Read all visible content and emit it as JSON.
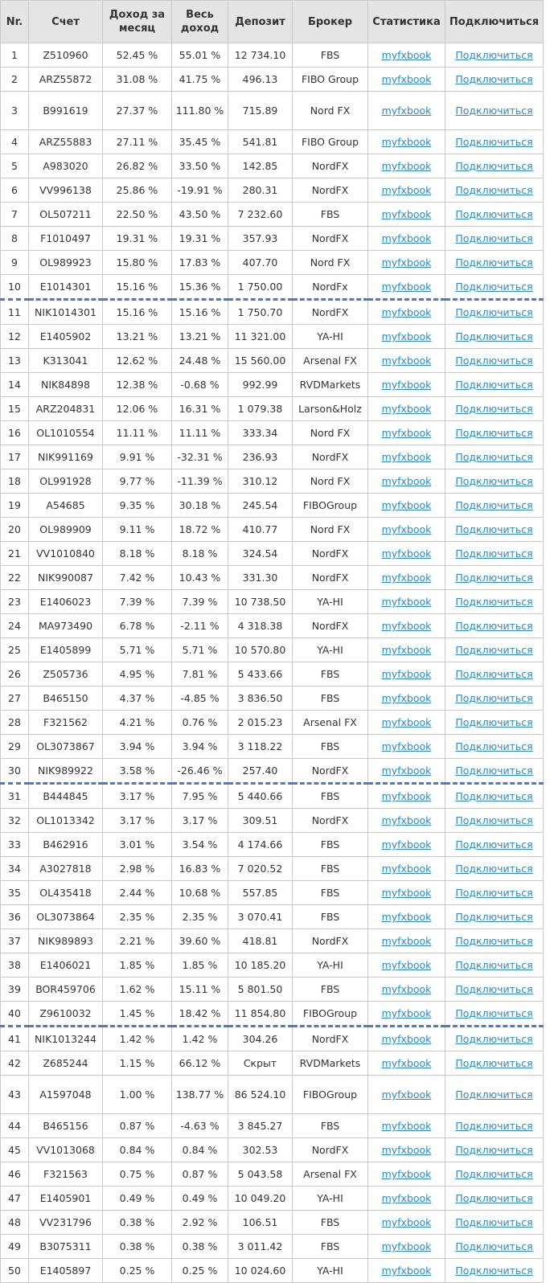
{
  "headers": [
    "Nr.",
    "Счет",
    "Доход за месяц",
    "Весь доход",
    "Депозит",
    "Брокер",
    "Статистика",
    "Подключиться"
  ],
  "separators_after": [
    10,
    30,
    40
  ],
  "rows": [
    {
      "nr": "1",
      "acc": "Z510960",
      "month": "52.45 %",
      "total": "55.01 %",
      "dep": "12 734.10",
      "broker": "FBS",
      "stat": "myfxbook",
      "conn": "Подключиться"
    },
    {
      "nr": "2",
      "acc": "ARZ55872",
      "month": "31.08 %",
      "total": "41.75 %",
      "dep": "496.13",
      "broker": "FIBO Group",
      "stat": "myfxbook",
      "conn": "Подключиться"
    },
    {
      "nr": "3",
      "acc": "B991619",
      "month": "27.37 %",
      "total": "111.80 %",
      "dep": "715.89",
      "broker": "Nord FX",
      "stat": "myfxbook",
      "conn": "Подключиться",
      "tall": true
    },
    {
      "nr": "4",
      "acc": "ARZ55883",
      "month": "27.11 %",
      "total": "35.45 %",
      "dep": "541.81",
      "broker": "FIBO Group",
      "stat": "myfxbook",
      "conn": "Подключиться"
    },
    {
      "nr": "5",
      "acc": "A983020",
      "month": "26.82 %",
      "total": "33.50 %",
      "dep": "142.85",
      "broker": "NordFX",
      "stat": "myfxbook",
      "conn": "Подключиться"
    },
    {
      "nr": "6",
      "acc": "VV996138",
      "month": "25.86 %",
      "total": "-19.91 %",
      "dep": "280.31",
      "broker": "NordFX",
      "stat": "myfxbook",
      "conn": "Подключиться"
    },
    {
      "nr": "7",
      "acc": "OL507211",
      "month": "22.50 %",
      "total": "43.50 %",
      "dep": "7 232.60",
      "broker": "FBS",
      "stat": "myfxbook",
      "conn": "Подключиться"
    },
    {
      "nr": "8",
      "acc": "F1010497",
      "month": "19.31 %",
      "total": "19.31 %",
      "dep": "357.93",
      "broker": "NordFX",
      "stat": "myfxbook",
      "conn": "Подключиться"
    },
    {
      "nr": "9",
      "acc": "OL989923",
      "month": "15.80 %",
      "total": "17.83 %",
      "dep": "407.70",
      "broker": "Nord FX",
      "stat": "myfxbook",
      "conn": "Подключиться"
    },
    {
      "nr": "10",
      "acc": "E1014301",
      "month": "15.16 %",
      "total": "15.36 %",
      "dep": "1 750.00",
      "broker": "NordFx",
      "stat": "myfxbook",
      "conn": "Подключиться"
    },
    {
      "nr": "11",
      "acc": "NIK1014301",
      "month": "15.16 %",
      "total": "15.16 %",
      "dep": "1 750.70",
      "broker": "NordFX",
      "stat": "myfxbook",
      "conn": "Подключиться"
    },
    {
      "nr": "12",
      "acc": "E1405902",
      "month": "13.21 %",
      "total": "13.21 %",
      "dep": "11 321.00",
      "broker": "YA-HI",
      "stat": "myfxbook",
      "conn": "Подключиться"
    },
    {
      "nr": "13",
      "acc": "K313041",
      "month": "12.62 %",
      "total": "24.48 %",
      "dep": "15 560.00",
      "broker": "Arsenal FX",
      "stat": "myfxbook",
      "conn": "Подключиться"
    },
    {
      "nr": "14",
      "acc": "NIK84898",
      "month": "12.38 %",
      "total": "-0.68 %",
      "dep": "992.99",
      "broker": "RVDMarkets",
      "stat": "myfxbook",
      "conn": "Подключиться"
    },
    {
      "nr": "15",
      "acc": "ARZ204831",
      "month": "12.06 %",
      "total": "16.31 %",
      "dep": "1 079.38",
      "broker": "Larson&Holz",
      "stat": "myfxbook",
      "conn": "Подключиться"
    },
    {
      "nr": "16",
      "acc": "OL1010554",
      "month": "11.11 %",
      "total": "11.11 %",
      "dep": "333.34",
      "broker": "Nord FX",
      "stat": "myfxbook",
      "conn": "Подключиться"
    },
    {
      "nr": "17",
      "acc": "NIK991169",
      "month": "9.91 %",
      "total": "-32.31 %",
      "dep": "236.93",
      "broker": "NordFX",
      "stat": "myfxbook",
      "conn": "Подключиться"
    },
    {
      "nr": "18",
      "acc": "OL991928",
      "month": "9.77 %",
      "total": "-11.39 %",
      "dep": "310.12",
      "broker": "Nord FX",
      "stat": "myfxbook",
      "conn": "Подключиться"
    },
    {
      "nr": "19",
      "acc": "A54685",
      "month": "9.35 %",
      "total": "30.18 %",
      "dep": "245.54",
      "broker": "FIBOGroup",
      "stat": "myfxbook",
      "conn": "Подключиться"
    },
    {
      "nr": "20",
      "acc": "OL989909",
      "month": "9.11 %",
      "total": "18.72 %",
      "dep": "410.77",
      "broker": "Nord FX",
      "stat": "myfxbook",
      "conn": "Подключиться"
    },
    {
      "nr": "21",
      "acc": "VV1010840",
      "month": "8.18 %",
      "total": "8.18 %",
      "dep": "324.54",
      "broker": "NordFX",
      "stat": "myfxbook",
      "conn": "Подключиться"
    },
    {
      "nr": "22",
      "acc": "NIK990087",
      "month": "7.42 %",
      "total": "10.43 %",
      "dep": "331.30",
      "broker": "NordFX",
      "stat": "myfxbook",
      "conn": "Подключиться"
    },
    {
      "nr": "23",
      "acc": "E1406023",
      "month": "7.39 %",
      "total": "7.39 %",
      "dep": "10 738.50",
      "broker": "YA-HI",
      "stat": "myfxbook",
      "conn": "Подключиться"
    },
    {
      "nr": "24",
      "acc": "MA973490",
      "month": "6.78 %",
      "total": "-2.11 %",
      "dep": "4 318.38",
      "broker": "NordFX",
      "stat": "myfxbook",
      "conn": "Подключиться"
    },
    {
      "nr": "25",
      "acc": "E1405899",
      "month": "5.71 %",
      "total": "5.71 %",
      "dep": "10 570.80",
      "broker": "YA-HI",
      "stat": "myfxbook",
      "conn": "Подключиться"
    },
    {
      "nr": "26",
      "acc": "Z505736",
      "month": "4.95 %",
      "total": "7.81 %",
      "dep": "5 433.66",
      "broker": "FBS",
      "stat": "myfxbook",
      "conn": "Подключиться"
    },
    {
      "nr": "27",
      "acc": "B465150",
      "month": "4.37 %",
      "total": "-4.85 %",
      "dep": "3 836.50",
      "broker": "FBS",
      "stat": "myfxbook",
      "conn": "Подключиться"
    },
    {
      "nr": "28",
      "acc": "F321562",
      "month": "4.21 %",
      "total": "0.76 %",
      "dep": "2 015.23",
      "broker": "Arsenal FX",
      "stat": "myfxbook",
      "conn": "Подключиться"
    },
    {
      "nr": "29",
      "acc": "OL3073867",
      "month": "3.94 %",
      "total": "3.94 %",
      "dep": "3 118.22",
      "broker": "FBS",
      "stat": "myfxbook",
      "conn": "Подключиться"
    },
    {
      "nr": "30",
      "acc": "NIK989922",
      "month": "3.58 %",
      "total": "-26.46 %",
      "dep": "257.40",
      "broker": "NordFX",
      "stat": "myfxbook",
      "conn": "Подключиться"
    },
    {
      "nr": "31",
      "acc": "B444845",
      "month": "3.17 %",
      "total": "7.95 %",
      "dep": "5 440.66",
      "broker": "FBS",
      "stat": "myfxbook",
      "conn": "Подключиться"
    },
    {
      "nr": "32",
      "acc": "OL1013342",
      "month": "3.17 %",
      "total": "3.17 %",
      "dep": "309.51",
      "broker": "NordFX",
      "stat": "myfxbook",
      "conn": "Подключиться"
    },
    {
      "nr": "33",
      "acc": "B462916",
      "month": "3.01 %",
      "total": "3.54 %",
      "dep": "4 174.66",
      "broker": "FBS",
      "stat": "myfxbook",
      "conn": "Подключиться"
    },
    {
      "nr": "34",
      "acc": "A3027818",
      "month": "2.98 %",
      "total": "16.83 %",
      "dep": "7 020.52",
      "broker": "FBS",
      "stat": "myfxbook",
      "conn": "Подключиться"
    },
    {
      "nr": "35",
      "acc": "OL435418",
      "month": "2.44 %",
      "total": "10.68 %",
      "dep": "557.85",
      "broker": "FBS",
      "stat": "myfxbook",
      "conn": "Подключиться"
    },
    {
      "nr": "36",
      "acc": "OL3073864",
      "month": "2.35 %",
      "total": "2.35 %",
      "dep": "3 070.41",
      "broker": "FBS",
      "stat": "myfxbook",
      "conn": "Подключиться"
    },
    {
      "nr": "37",
      "acc": "NIK989893",
      "month": "2.21 %",
      "total": "39.60 %",
      "dep": "418.81",
      "broker": "NordFX",
      "stat": "myfxbook",
      "conn": "Подключиться"
    },
    {
      "nr": "38",
      "acc": "E1406021",
      "month": "1.85 %",
      "total": "1.85 %",
      "dep": "10 185.20",
      "broker": "YA-HI",
      "stat": "myfxbook",
      "conn": "Подключиться"
    },
    {
      "nr": "39",
      "acc": "BOR459706",
      "month": "1.62 %",
      "total": "15.11 %",
      "dep": "5 801.50",
      "broker": "FBS",
      "stat": "myfxbook",
      "conn": "Подключиться"
    },
    {
      "nr": "40",
      "acc": "Z9610032",
      "month": "1.45 %",
      "total": "18.42 %",
      "dep": "11 854.80",
      "broker": "FIBOGroup",
      "stat": "myfxbook",
      "conn": "Подключиться"
    },
    {
      "nr": "41",
      "acc": "NIK1013244",
      "month": "1.42 %",
      "total": "1.42 %",
      "dep": "304.26",
      "broker": "NordFX",
      "stat": "myfxbook",
      "conn": "Подключиться"
    },
    {
      "nr": "42",
      "acc": "Z685244",
      "month": "1.15 %",
      "total": "66.12 %",
      "dep": "Скрыт",
      "broker": "RVDMarkets",
      "stat": "myfxbook",
      "conn": "Подключиться"
    },
    {
      "nr": "43",
      "acc": "A1597048",
      "month": "1.00 %",
      "total": "138.77 %",
      "dep": "86 524.10",
      "broker": "FIBOGroup",
      "stat": "myfxbook",
      "conn": "Подключиться",
      "tall": true
    },
    {
      "nr": "44",
      "acc": "B465156",
      "month": "0.87 %",
      "total": "-4.63 %",
      "dep": "3 845.27",
      "broker": "FBS",
      "stat": "myfxbook",
      "conn": "Подключиться"
    },
    {
      "nr": "45",
      "acc": "VV1013068",
      "month": "0.84 %",
      "total": "0.84 %",
      "dep": "302.53",
      "broker": "NordFX",
      "stat": "myfxbook",
      "conn": "Подключиться"
    },
    {
      "nr": "46",
      "acc": "F321563",
      "month": "0.75 %",
      "total": "0.87 %",
      "dep": "5 043.58",
      "broker": "Arsenal FX",
      "stat": "myfxbook",
      "conn": "Подключиться"
    },
    {
      "nr": "47",
      "acc": "E1405901",
      "month": "0.49 %",
      "total": "0.49 %",
      "dep": "10 049.20",
      "broker": "YA-HI",
      "stat": "myfxbook",
      "conn": "Подключиться"
    },
    {
      "nr": "48",
      "acc": "VV231796",
      "month": "0.38 %",
      "total": "2.92 %",
      "dep": "106.51",
      "broker": "FBS",
      "stat": "myfxbook",
      "conn": "Подключиться"
    },
    {
      "nr": "49",
      "acc": "B3075311",
      "month": "0.38 %",
      "total": "0.38 %",
      "dep": "3 011.42",
      "broker": "FBS",
      "stat": "myfxbook",
      "conn": "Подключиться"
    },
    {
      "nr": "50",
      "acc": "E1405897",
      "month": "0.25 %",
      "total": "0.25 %",
      "dep": "10 024.60",
      "broker": "YA-HI",
      "stat": "myfxbook",
      "conn": "Подключиться"
    }
  ]
}
